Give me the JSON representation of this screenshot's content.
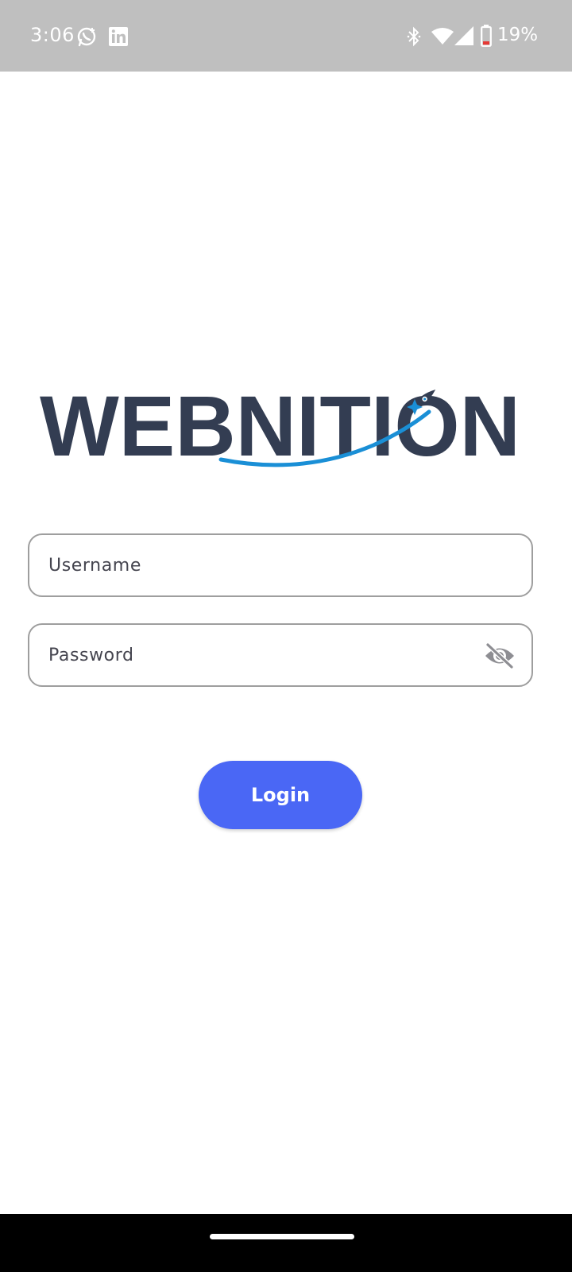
{
  "status_bar": {
    "time": "3:06",
    "battery_percent": "19%",
    "background_color": "#bfbfbf",
    "icons": [
      "whatsapp-icon",
      "linkedin-icon",
      "bluetooth-icon",
      "wifi-icon",
      "signal-icon",
      "battery-icon"
    ]
  },
  "logo": {
    "text": "WEBNITION",
    "text_color": "#333d52",
    "accent_color": "#1a8fd6"
  },
  "form": {
    "username": {
      "placeholder": "Username",
      "value": ""
    },
    "password": {
      "placeholder": "Password",
      "value": "",
      "toggle_icon": "eye-off-icon"
    },
    "login_label": "Login",
    "button_color": "#4a67f5"
  },
  "nav_bar": {
    "color": "#000000"
  }
}
